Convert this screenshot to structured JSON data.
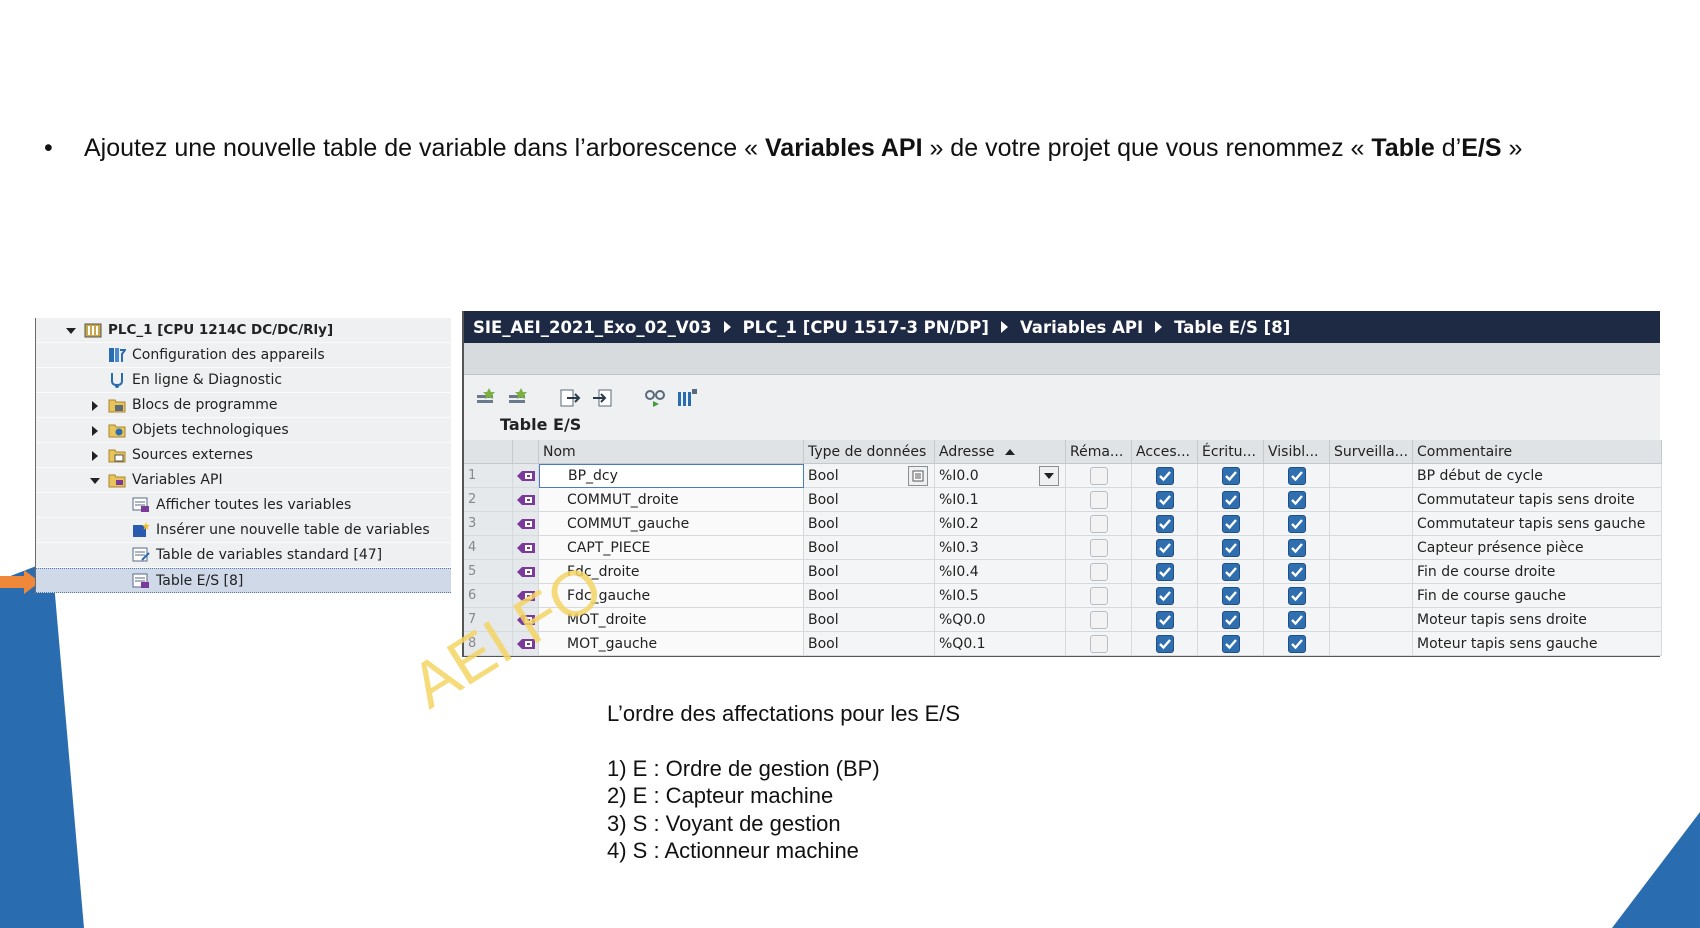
{
  "instruction": {
    "bullet": "•",
    "p1": "Ajoutez une nouvelle table de variable dans l’arborescence « ",
    "b1": "Variables API",
    "p2": " » de votre projet que vous renommez « ",
    "b2": "Table",
    "p3": " d’",
    "b3": "E/S",
    "p4": " »"
  },
  "tree": {
    "root": "PLC_1 [CPU 1214C DC/DC/Rly]",
    "items": [
      {
        "label": "Configuration des appareils",
        "icon": "device-config-icon"
      },
      {
        "label": "En ligne & Diagnostic",
        "icon": "online-diagnostic-icon"
      },
      {
        "label": "Blocs de programme",
        "icon": "program-blocks-folder-icon"
      },
      {
        "label": "Objets technologiques",
        "icon": "technology-objects-folder-icon"
      },
      {
        "label": "Sources externes",
        "icon": "external-sources-folder-icon"
      },
      {
        "label": "Variables API",
        "icon": "plc-tags-folder-icon"
      },
      {
        "label": "Afficher toutes les variables",
        "icon": "show-all-tags-icon"
      },
      {
        "label": "Insérer une nouvelle table de variables",
        "icon": "add-tag-table-icon"
      },
      {
        "label": "Table de variables standard [47]",
        "icon": "tag-table-icon"
      },
      {
        "label": "Table E/S [8]",
        "icon": "tag-table-icon"
      }
    ]
  },
  "window": {
    "breadcrumb": [
      "SIE_AEI_2021_Exo_02_V03",
      "PLC_1 [CPU 1517-3 PN/DP]",
      "Variables API",
      "Table E/S [8]"
    ],
    "table_title": "Table E/S",
    "columns": [
      "Nom",
      "Type de données",
      "Adresse",
      "Réma...",
      "Acces...",
      "Écritu...",
      "Visibl...",
      "Surveilla...",
      "Commentaire"
    ],
    "rows": [
      {
        "n": "1",
        "name": "BP_dcy",
        "type": "Bool",
        "addr": "%I0.0",
        "remanent": false,
        "access": true,
        "write": true,
        "visible": true,
        "comment": "BP début de cycle"
      },
      {
        "n": "2",
        "name": "COMMUT_droite",
        "type": "Bool",
        "addr": "%I0.1",
        "remanent": false,
        "access": true,
        "write": true,
        "visible": true,
        "comment": "Commutateur tapis sens droite"
      },
      {
        "n": "3",
        "name": "COMMUT_gauche",
        "type": "Bool",
        "addr": "%I0.2",
        "remanent": false,
        "access": true,
        "write": true,
        "visible": true,
        "comment": "Commutateur tapis sens gauche"
      },
      {
        "n": "4",
        "name": "CAPT_PIECE",
        "type": "Bool",
        "addr": "%I0.3",
        "remanent": false,
        "access": true,
        "write": true,
        "visible": true,
        "comment": "Capteur présence pièce"
      },
      {
        "n": "5",
        "name": "Fdc_droite",
        "type": "Bool",
        "addr": "%I0.4",
        "remanent": false,
        "access": true,
        "write": true,
        "visible": true,
        "comment": "Fin de course droite"
      },
      {
        "n": "6",
        "name": "Fdc_gauche",
        "type": "Bool",
        "addr": "%I0.5",
        "remanent": false,
        "access": true,
        "write": true,
        "visible": true,
        "comment": "Fin de course gauche"
      },
      {
        "n": "7",
        "name": "MOT_droite",
        "type": "Bool",
        "addr": "%Q0.0",
        "remanent": false,
        "access": true,
        "write": true,
        "visible": true,
        "comment": "Moteur tapis sens droite"
      },
      {
        "n": "8",
        "name": "MOT_gauche",
        "type": "Bool",
        "addr": "%Q0.1",
        "remanent": false,
        "access": true,
        "write": true,
        "visible": true,
        "comment": "Moteur tapis sens gauche"
      }
    ]
  },
  "watermark": "AEI FO",
  "order": {
    "title": "L’ordre des affectations pour les E/S",
    "items": [
      "1) E : Ordre de gestion (BP)",
      "2) E : Capteur machine",
      "3) S : Voyant  de gestion",
      "4) S : Actionneur machine"
    ]
  },
  "colors": {
    "title_bar": "#1e2a44",
    "checkbox": "#2f6fb0",
    "slide_blue": "#2a6cb0",
    "arrow_orange": "#f0883a",
    "watermark": "#f5d565"
  }
}
